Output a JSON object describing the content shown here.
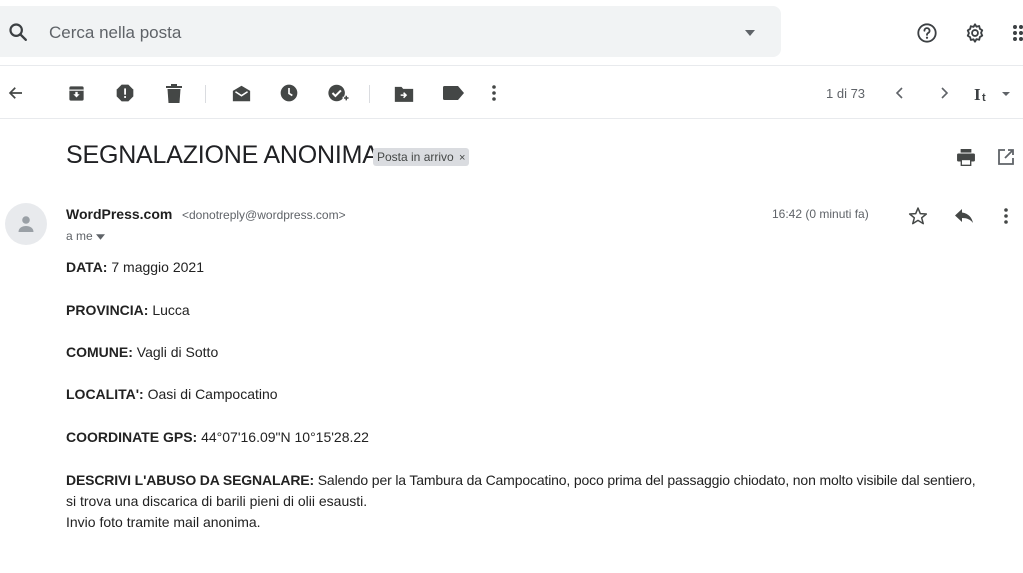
{
  "search": {
    "placeholder": "Cerca nella posta"
  },
  "icons": {
    "search": "search-icon",
    "search_options": "arrow-drop-down-icon",
    "help": "help-icon",
    "settings": "gear-icon",
    "apps": "apps-grid-icon",
    "back": "arrow-back-icon",
    "archive": "archive-icon",
    "spam": "report-spam-icon",
    "delete": "trash-icon",
    "mark_unread": "mark-unread-icon",
    "snooze": "snooze-icon",
    "add_task": "add-task-icon",
    "move_to": "move-to-folder-icon",
    "labels": "label-icon",
    "more": "more-vert-icon",
    "prev": "chevron-left-icon",
    "next": "chevron-right-icon",
    "input_tools": "input-tools-icon",
    "print": "print-icon",
    "new_window": "open-new-window-icon",
    "star": "star-icon",
    "reply": "reply-icon",
    "avatar": "person-icon"
  },
  "colors": {
    "icon_gray": "#5f6368",
    "toolbar_icon": "#444746",
    "chip_bg": "#dadce0",
    "search_bg": "#f1f3f4"
  },
  "toolbar": {
    "pager": "1 di 73"
  },
  "message": {
    "subject": "SEGNALAZIONE ANONIMA",
    "label": "Posta in arrivo",
    "label_remove": "×",
    "sender_name": "WordPress.com",
    "sender_email": "<donotreply@wordpress.com>",
    "to": "a me",
    "time": "16:42 (0 minuti fa)"
  },
  "body": {
    "data_label": "DATA:",
    "data_value": " 7 maggio 2021",
    "provincia_label": "PROVINCIA:",
    "provincia_value": " Lucca",
    "comune_label": "COMUNE:",
    "comune_value": " Vagli di Sotto",
    "localita_label": "LOCALITA':",
    "localita_value": " Oasi di Campocatino",
    "gps_label": "COORDINATE GPS:",
    "gps_value": " 44°07'16.09\"N 10°15'28.22",
    "descr_label": "DESCRIVI L'ABUSO DA SEGNALARE:",
    "descr_line1": " Salendo per la Tambura da Campocatino, poco prima del passaggio chiodato, non molto visibile dal sentiero,",
    "descr_line2": "si trova una discarica di barili pieni di olii esausti.",
    "descr_line3": "Invio foto tramite mail anonima."
  }
}
